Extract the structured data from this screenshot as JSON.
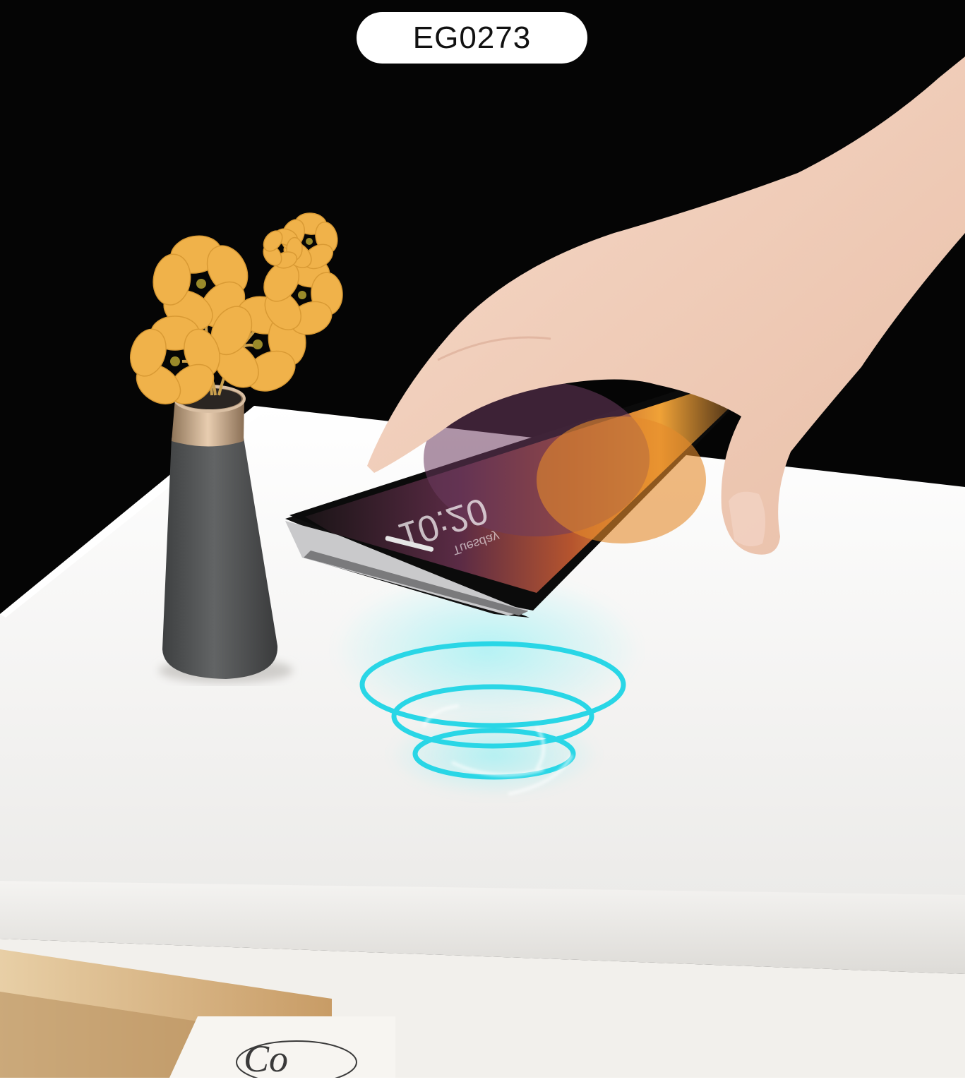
{
  "badge": {
    "model_code": "EG0273"
  },
  "phone_screen": {
    "lock_time": "10:20",
    "date_line": "Tuesday"
  },
  "drawer_text": "Co",
  "colors": {
    "background": "#050505",
    "tabletop": "#f4f3f1",
    "wireless_glow": "#29d6e6",
    "flower": "#f0b24a",
    "vase": "#555758",
    "vase_collar": "#c9a98a",
    "drawer_wood": "#d9b98d"
  }
}
